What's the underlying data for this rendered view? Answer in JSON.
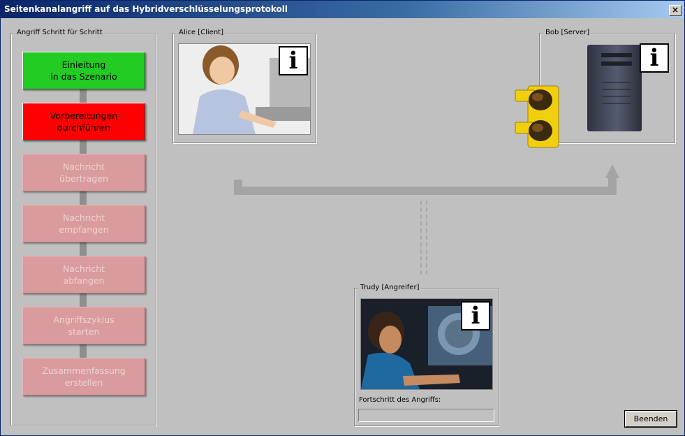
{
  "window": {
    "title": "Seitenkanalangriff auf das Hybridverschlüsselungsprotokoll",
    "close_label": "×"
  },
  "steps_panel": {
    "legend": "Angriff Schritt für Schritt",
    "steps": [
      {
        "label": "Einleitung\nin das Szenario",
        "state": "done"
      },
      {
        "label": "Vorbereitungen\ndurchführen",
        "state": "current"
      },
      {
        "label": "Nachricht\nübertragen",
        "state": "disabled"
      },
      {
        "label": "Nachricht\nempfangen",
        "state": "disabled"
      },
      {
        "label": "Nachricht\nabfangen",
        "state": "disabled"
      },
      {
        "label": "Angriffszyklus\nstarten",
        "state": "disabled"
      },
      {
        "label": "Zusammenfassung\nerstellen",
        "state": "disabled"
      }
    ]
  },
  "alice": {
    "legend": "Alice [Client]",
    "info_icon": "info-icon"
  },
  "bob": {
    "legend": "Bob [Server]",
    "info_icon": "info-icon"
  },
  "trudy": {
    "legend": "Trudy [Angreifer]",
    "info_icon": "info-icon",
    "progress_label": "Fortschritt des Angriffs:",
    "progress": 0
  },
  "footer": {
    "quit_label": "Beenden"
  },
  "colors": {
    "step_done": "#22cc22",
    "step_current": "#ff0000",
    "step_disabled": "#d99b9e",
    "titlebar": "#0a246a"
  }
}
